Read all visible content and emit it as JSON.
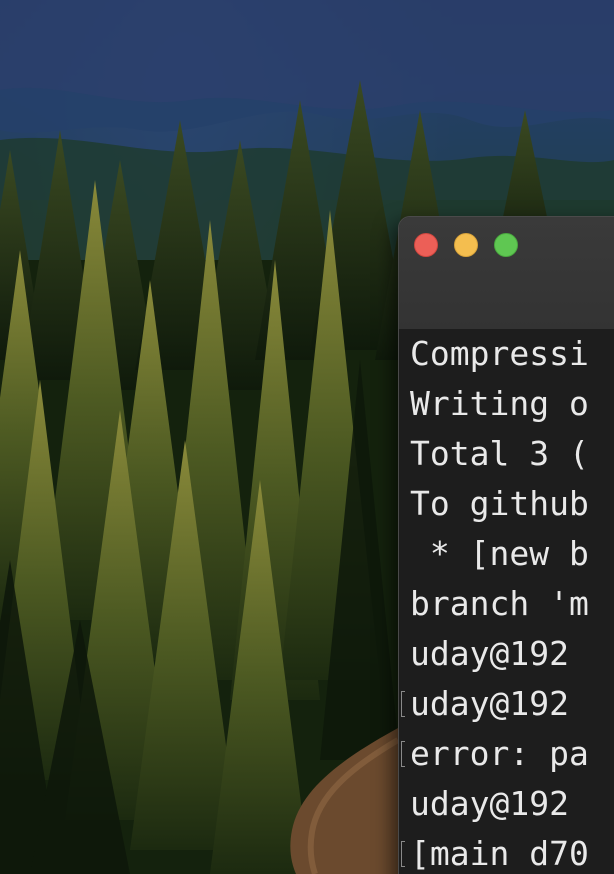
{
  "desktop": {
    "wallpaper_icon": "forest-wallpaper"
  },
  "terminal": {
    "window_controls": {
      "close_color": "#ec5f57",
      "minimize_color": "#f4be4f",
      "zoom_color": "#5fc752"
    },
    "lines": [
      {
        "text": "Compressi"
      },
      {
        "text": "Writing o"
      },
      {
        "text": "Total 3 ("
      },
      {
        "text": "To github"
      },
      {
        "text": " * [new b"
      },
      {
        "text": "branch 'm"
      },
      {
        "text": "uday@192 "
      },
      {
        "text": "uday@192 "
      },
      {
        "text": "error: pa"
      },
      {
        "text": "uday@192 "
      },
      {
        "text": "[main d70"
      }
    ]
  }
}
